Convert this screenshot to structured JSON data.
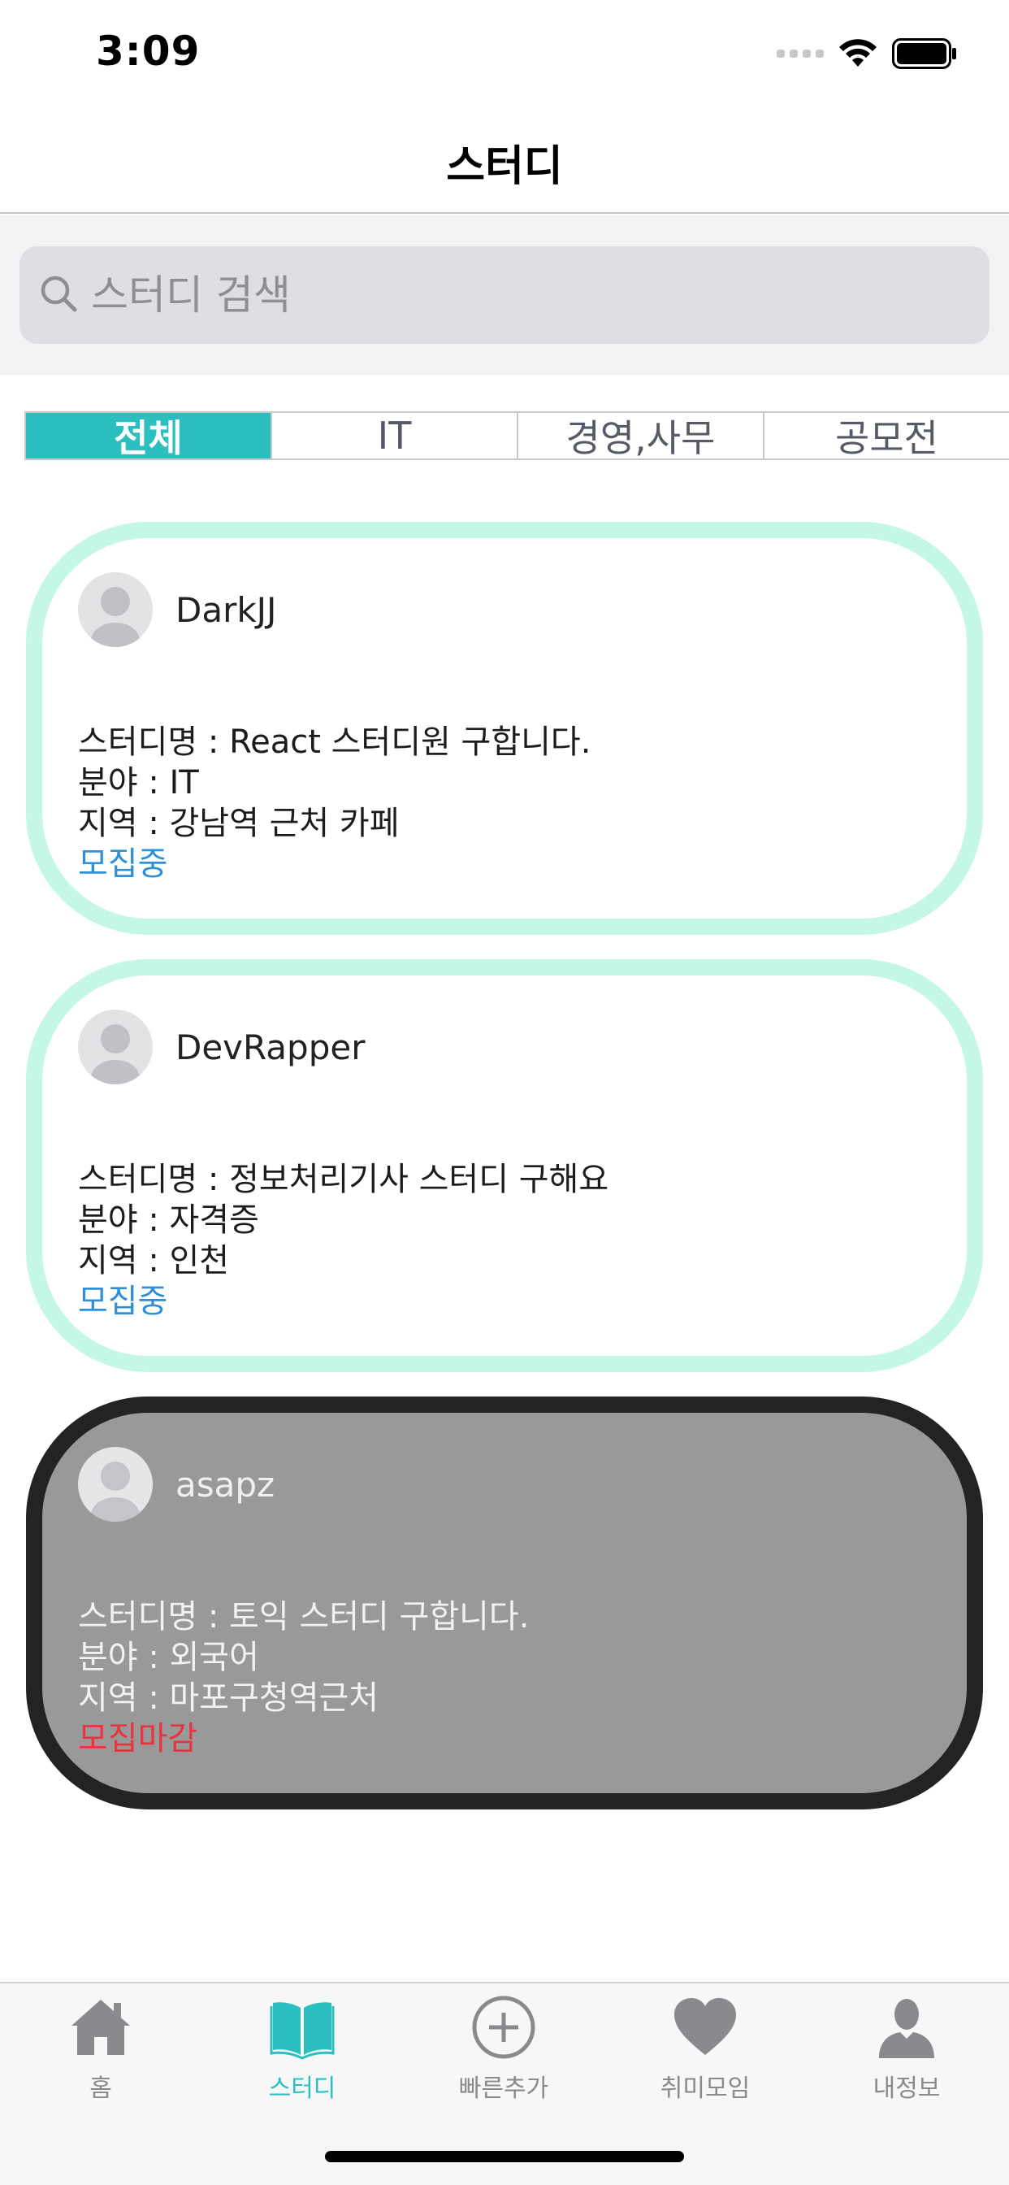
{
  "status_bar": {
    "time": "3:09"
  },
  "nav": {
    "title": "스터디"
  },
  "search": {
    "placeholder": "스터디 검색"
  },
  "categories": [
    {
      "label": "전체",
      "active": true
    },
    {
      "label": "IT",
      "active": false
    },
    {
      "label": "경영,사무",
      "active": false
    },
    {
      "label": "공모전",
      "active": false
    }
  ],
  "studies": [
    {
      "username": "DarkJJ",
      "name_line": "스터디명 : React 스터디원 구합니다.",
      "field_line": "분야 : IT",
      "location_line": "지역 : 강남역 근처 카페",
      "status": "모집중",
      "closed": false
    },
    {
      "username": "DevRapper",
      "name_line": "스터디명 : 정보처리기사 스터디 구해요",
      "field_line": "분야 : 자격증",
      "location_line": "지역 : 인천",
      "status": "모집중",
      "closed": false
    },
    {
      "username": "asapz",
      "name_line": "스터디명 : 토익 스터디 구합니다.",
      "field_line": "분야 : 외국어",
      "location_line": "지역 : 마포구청역근처",
      "status": "모집마감",
      "closed": true
    }
  ],
  "tab_bar": [
    {
      "label": "홈",
      "icon": "house-icon",
      "active": false
    },
    {
      "label": "스터디",
      "icon": "book-icon",
      "active": true
    },
    {
      "label": "빠른추가",
      "icon": "plus-circle-icon",
      "active": false
    },
    {
      "label": "취미모임",
      "icon": "heart-icon",
      "active": false
    },
    {
      "label": "내정보",
      "icon": "person-icon",
      "active": false
    }
  ],
  "colors": {
    "accent": "#2bbfbf",
    "card_border_open": "#c4f7e6",
    "card_border_closed": "#232323",
    "card_bg_closed": "#999999",
    "status_open": "#2f8fd8",
    "status_closed": "#e8343f"
  }
}
